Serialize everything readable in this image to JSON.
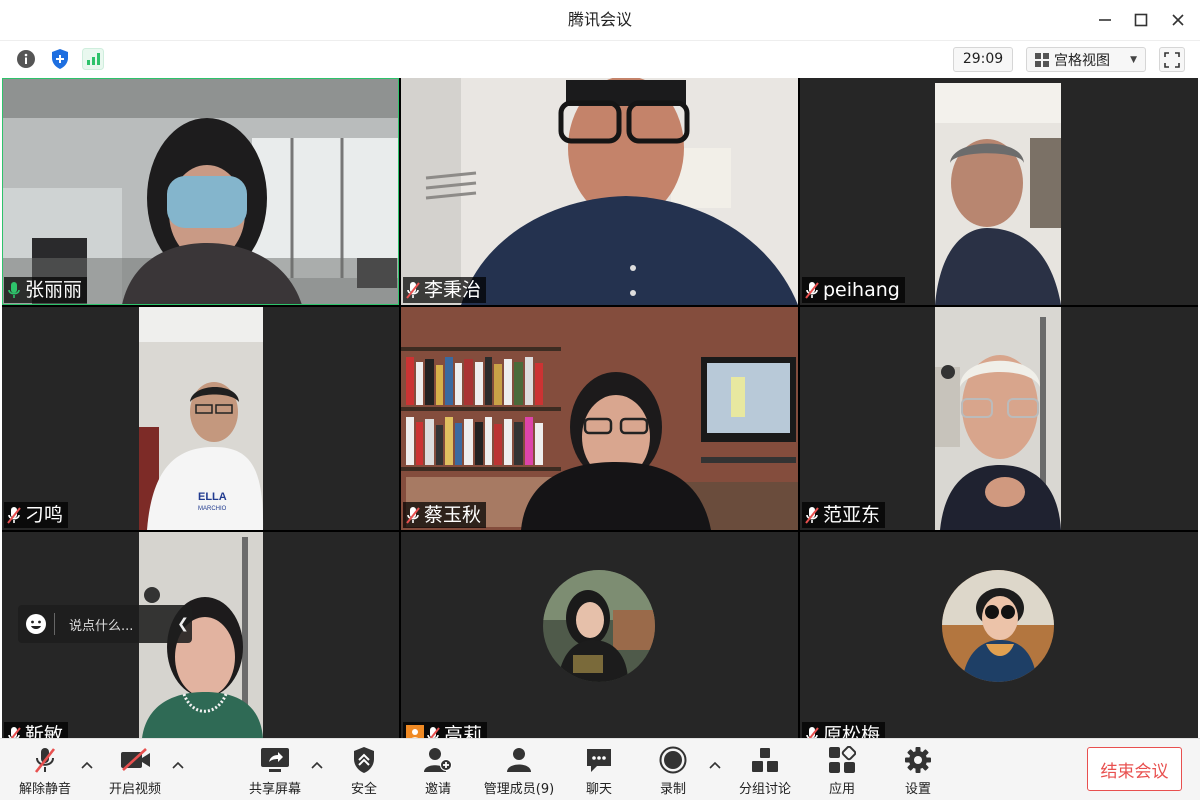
{
  "window": {
    "title": "腾讯会议"
  },
  "status": {
    "timer": "29:09",
    "view_label": "宫格视图"
  },
  "participants": [
    {
      "name": "张丽丽",
      "mic": "on"
    },
    {
      "name": "李秉治",
      "mic": "muted"
    },
    {
      "name": "peihang",
      "mic": "muted"
    },
    {
      "name": "刁鸣",
      "mic": "muted"
    },
    {
      "name": "蔡玉秋",
      "mic": "muted"
    },
    {
      "name": "范亚东",
      "mic": "muted"
    },
    {
      "name": "靳敏",
      "mic": "muted"
    },
    {
      "name": "高莉",
      "mic": "muted"
    },
    {
      "name": "原松梅",
      "mic": "muted"
    }
  ],
  "shirt_text": {
    "line1": "ELLA",
    "line2": "MARCHIO"
  },
  "chat": {
    "placeholder": "说点什么..."
  },
  "toolbar": {
    "unmute": "解除静音",
    "start_video": "开启视频",
    "share": "共享屏幕",
    "security": "安全",
    "invite": "邀请",
    "members": "管理成员(9)",
    "chat": "聊天",
    "record": "录制",
    "breakout": "分组讨论",
    "apps": "应用",
    "settings": "设置",
    "end": "结束会议"
  },
  "colors": {
    "mic_on": "#2ec26b",
    "muted": "#e8504f",
    "end": "#e8504f",
    "signal": "#2ec26b",
    "shield": "#1e6fe0"
  }
}
